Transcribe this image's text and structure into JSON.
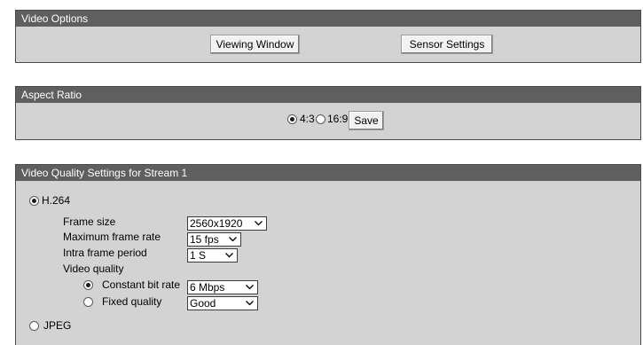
{
  "video_options": {
    "title": "Video Options",
    "viewing_window_label": "Viewing Window",
    "sensor_settings_label": "Sensor Settings"
  },
  "aspect_ratio": {
    "title": "Aspect Ratio",
    "options": [
      {
        "label": "4:3",
        "selected": true
      },
      {
        "label": "16:9",
        "selected": false
      }
    ],
    "save_label": "Save"
  },
  "stream": {
    "title": "Video Quality Settings for Stream 1",
    "codec_h264_label": "H.264",
    "codec_h264_selected": true,
    "frame_size_label": "Frame size",
    "frame_size_value": "2560x1920",
    "max_frame_rate_label": "Maximum frame rate",
    "max_frame_rate_value": "15 fps",
    "intra_frame_label": "Intra frame period",
    "intra_frame_value": "1 S",
    "video_quality_label": "Video quality",
    "constant_bit_rate_label": "Constant bit rate",
    "constant_bit_rate_selected": true,
    "constant_bit_rate_value": "6 Mbps",
    "fixed_quality_label": "Fixed quality",
    "fixed_quality_selected": false,
    "fixed_quality_value": "Good",
    "codec_jpeg_label": "JPEG",
    "codec_jpeg_selected": false
  }
}
